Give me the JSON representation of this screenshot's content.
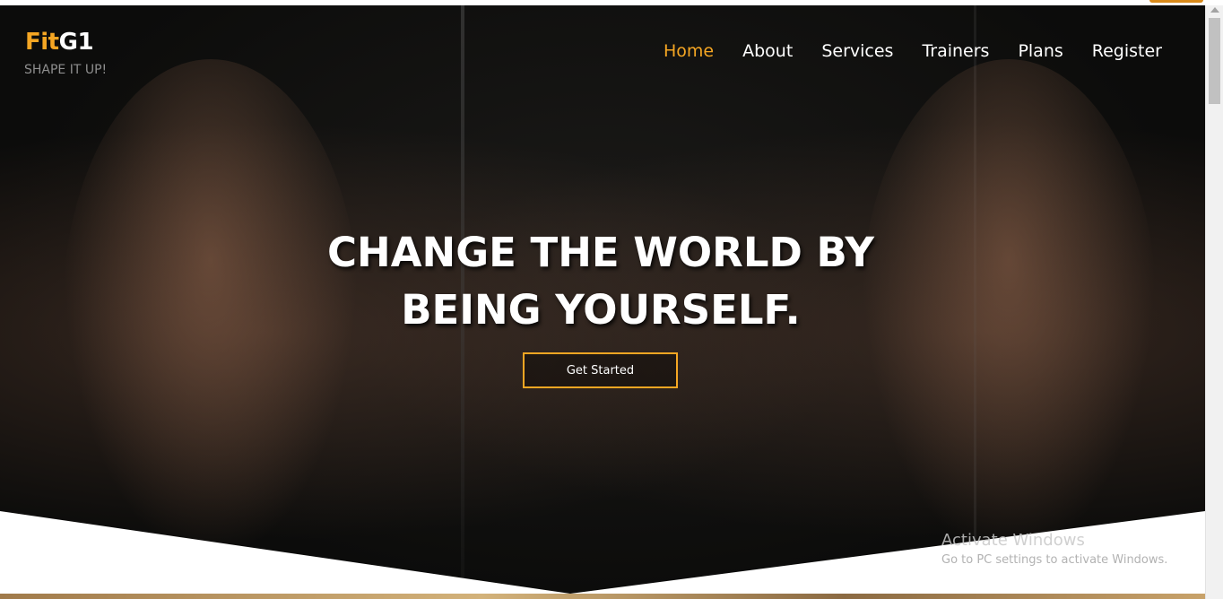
{
  "brand": {
    "name_part1": "Fit",
    "name_part2": "G1",
    "tagline": "SHAPE IT UP!",
    "accent_color": "#f5a623"
  },
  "nav": {
    "items": [
      {
        "label": "Home",
        "active": true
      },
      {
        "label": "About",
        "active": false
      },
      {
        "label": "Services",
        "active": false
      },
      {
        "label": "Trainers",
        "active": false
      },
      {
        "label": "Plans",
        "active": false
      },
      {
        "label": "Register",
        "active": false
      }
    ]
  },
  "hero": {
    "headline_line1": "CHANGE THE WORLD BY",
    "headline_line2": "BEING YOURSELF.",
    "cta_label": "Get Started"
  },
  "windows_watermark": {
    "title": "Activate Windows",
    "subtitle": "Go to PC settings to activate Windows."
  }
}
